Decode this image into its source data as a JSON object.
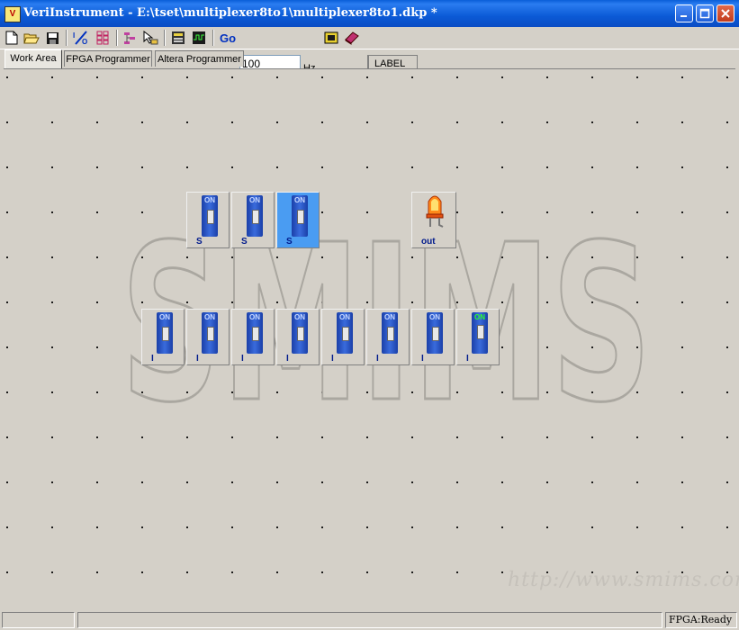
{
  "window": {
    "title": "VeriInstrument - E:\\tset\\multiplexer8to1\\multiplexer8to1.dkp *"
  },
  "toolbar": {
    "icons": [
      "new-file-icon",
      "open-folder-icon",
      "save-icon",
      "io-icon",
      "grid-icon",
      "tree-icon",
      "pointer-icon",
      "panel-icon",
      "waveform-icon",
      "go-icon",
      "chip-icon",
      "book-icon"
    ],
    "go_label": "Go",
    "frequency": "100",
    "frequency_unit": "Hz",
    "label_button": "LABEL"
  },
  "tabs": [
    {
      "label": "Work Area",
      "active": true
    },
    {
      "label": "FPGA Programmer",
      "active": false
    },
    {
      "label": "Altera Programmer",
      "active": false
    }
  ],
  "work_area": {
    "watermark_text": "SMIMS",
    "url_text": "http://www.smims.com",
    "select_switches": [
      {
        "on_label": "ON",
        "label": "S",
        "selected": false
      },
      {
        "on_label": "ON",
        "label": "S",
        "selected": false
      },
      {
        "on_label": "ON",
        "label": "S",
        "selected": true
      }
    ],
    "output_led": {
      "label": "out"
    },
    "input_switches": [
      {
        "on_label": "ON",
        "label": "I",
        "on": false
      },
      {
        "on_label": "ON",
        "label": "I",
        "on": false
      },
      {
        "on_label": "ON",
        "label": "I",
        "on": false
      },
      {
        "on_label": "ON",
        "label": "I",
        "on": false
      },
      {
        "on_label": "ON",
        "label": "I",
        "on": false
      },
      {
        "on_label": "ON",
        "label": "I",
        "on": false
      },
      {
        "on_label": "ON",
        "label": "I",
        "on": false
      },
      {
        "on_label": "ON",
        "label": "I",
        "on": true
      }
    ]
  },
  "statusbar": {
    "fpga_status": "FPGA:Ready"
  },
  "colors": {
    "titlebar": "#0a5fd8",
    "switch_body": "#2a55c8",
    "selected_switch": "#4a9cf2",
    "on_lit": "#2bff2b"
  }
}
